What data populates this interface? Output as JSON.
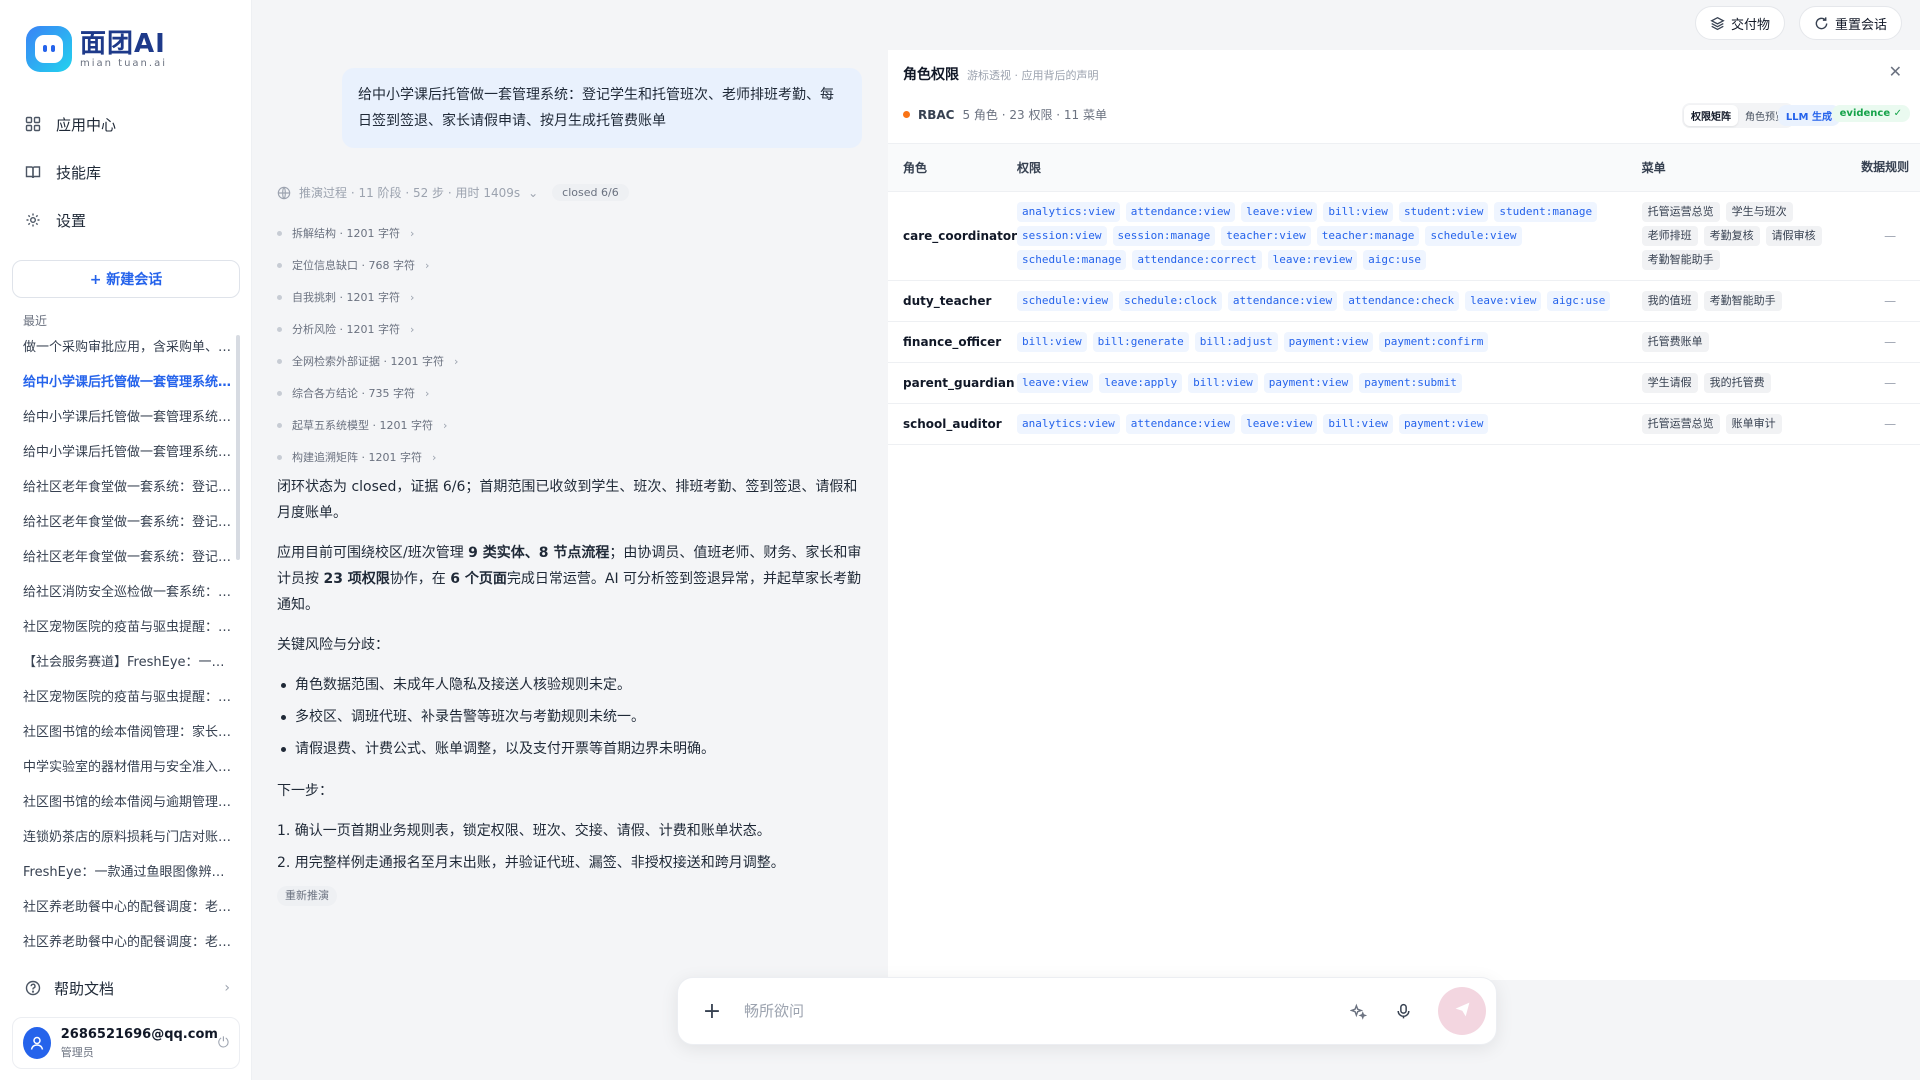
{
  "app": {
    "logo_title": "面团AI",
    "logo_sub": "mian tuan.ai"
  },
  "nav": [
    {
      "label": "应用中心",
      "icon": "grid-icon"
    },
    {
      "label": "技能库",
      "icon": "book-icon"
    },
    {
      "label": "设置",
      "icon": "gear-icon"
    }
  ],
  "new_chat_label": "+ 新建会话",
  "recent_label": "最近",
  "history": [
    "做一个采购审批应用，含采购单、经理审批和财务确认",
    "给中小学课后托管做一套管理系统：登记学生和托管班次",
    "给中小学课后托管做一套管理系统：登记学生和托管班次",
    "给中小学课后托管做一套管理系统：登记学生和托管班次",
    "给社区老年食堂做一套系统：登记就餐老人和餐次",
    "给社区老年食堂做一套系统：登记就餐老人和餐次",
    "给社区老年食堂做一套系统：登记就餐老人和餐次",
    "给社区消防安全巡检做一套系统：登记巡检点位",
    "社区宠物医院的疫苗与驱虫提醒：建立宠物档案",
    "【社会服务赛道】FreshEye：一款通过鱼眼图像辨别",
    "社区宠物医院的疫苗与驱虫提醒：建立宠物档案",
    "社区图书馆的绘本借阅管理：家长预约绘本",
    "中学实验室的器材借用与安全准入：登记器材",
    "社区图书馆的绘本借阅与逾期管理：登记读者",
    "连锁奶茶店的原料损耗与门店对账：登记原料",
    "FreshEye：一款通过鱼眼图像辨别水产新鲜度",
    "社区养老助餐中心的配餐调度：老人订餐",
    "社区养老助餐中心的配餐调度：老人订餐"
  ],
  "help_label": "帮助文档",
  "user": {
    "email": "2686521696@qq.com",
    "role": "管理员"
  },
  "top_buttons": {
    "deliverables": "交付物",
    "reset": "重置会话"
  },
  "chat": {
    "user_message": "给中小学课后托管做一套管理系统：登记学生和托管班次、老师排班考勤、每日签到签退、家长请假申请、按月生成托管费账单",
    "reasoning_summary": "推演过程 · 11 阶段 · 52 步 · 用时 1409s",
    "closed_tag": "closed 6/6",
    "steps": [
      "拆解结构 · 1201 字符",
      "定位信息缺口 · 768 字符",
      "自我挑刺 · 1201 字符",
      "分析风险 · 1201 字符",
      "全网检索外部证据 · 1201 字符",
      "综合各方结论 · 735 字符",
      "起草五系统模型 · 1201 字符",
      "构建追溯矩阵 · 1201 字符"
    ],
    "answer": {
      "p1": "闭环状态为 closed，证据 6/6；首期范围已收敛到学生、班次、排班考勤、签到签退、请假和月度账单。",
      "p2a": "应用目前可围绕校区/班次管理 ",
      "p2b": "9 类实体、8 节点流程",
      "p2c": "；由协调员、值班老师、财务、家长和审计员按 ",
      "p2d": "23 项权限",
      "p2e": "协作，在 ",
      "p2f": "6 个页面",
      "p2g": "完成日常运营。AI 可分析签到签退异常，并起草家长考勤通知。",
      "risk_title": "关键风险与分歧：",
      "risks": [
        "角色数据范围、未成年人隐私及接送人核验规则未定。",
        "多校区、调班代班、补录告警等班次与考勤规则未统一。",
        "请假退费、计费公式、账单调整，以及支付开票等首期边界未明确。"
      ],
      "next_title": "下一步：",
      "next_steps": [
        "1. 确认一页首期业务规则表，锁定权限、班次、交接、请假、计费和账单状态。",
        "2. 用完整样例走通报名至月末出账，并验证代班、漏签、非授权接送和跨月调整。"
      ],
      "rerun": "重新推演"
    }
  },
  "panel": {
    "title": "角色权限",
    "subtitle": "游标透视 · 应用背后的声明",
    "rbac_label": "RBAC",
    "rbac_meta": "5 角色 · 23 权限 · 11 菜单",
    "tabs": [
      "权限矩阵",
      "角色预览"
    ],
    "llm_badge": "LLM 生成",
    "evidence_badge": "evidence ✓",
    "columns": {
      "role": "角色",
      "perm": "权限",
      "menu": "菜单",
      "rule": "数据规则"
    },
    "rows": [
      {
        "role": "care_coordinator",
        "perms": [
          "analytics:view",
          "attendance:view",
          "leave:view",
          "bill:view",
          "student:view",
          "student:manage",
          "session:view",
          "session:manage",
          "teacher:view",
          "teacher:manage",
          "schedule:view",
          "schedule:manage",
          "attendance:correct",
          "leave:review",
          "aigc:use"
        ],
        "menus": [
          "托管运营总览",
          "学生与班次",
          "老师排班",
          "考勤复核",
          "请假审核",
          "考勤智能助手"
        ],
        "rule": "—"
      },
      {
        "role": "duty_teacher",
        "perms": [
          "schedule:view",
          "schedule:clock",
          "attendance:view",
          "attendance:check",
          "leave:view",
          "aigc:use"
        ],
        "menus": [
          "我的值班",
          "考勤智能助手"
        ],
        "rule": "—"
      },
      {
        "role": "finance_officer",
        "perms": [
          "bill:view",
          "bill:generate",
          "bill:adjust",
          "payment:view",
          "payment:confirm"
        ],
        "menus": [
          "托管费账单"
        ],
        "rule": "—"
      },
      {
        "role": "parent_guardian",
        "perms": [
          "leave:view",
          "leave:apply",
          "bill:view",
          "payment:view",
          "payment:submit"
        ],
        "menus": [
          "学生请假",
          "我的托管费"
        ],
        "rule": "—"
      },
      {
        "role": "school_auditor",
        "perms": [
          "analytics:view",
          "attendance:view",
          "leave:view",
          "bill:view",
          "payment:view"
        ],
        "menus": [
          "托管运营总览",
          "账单审计"
        ],
        "rule": "—"
      }
    ]
  },
  "composer": {
    "placeholder": "畅所欲问"
  },
  "colors": {
    "accent": "#2563eb",
    "bubble": "#e9f1fd",
    "rbac_dot": "#f97316",
    "send": "#f3d6e0"
  }
}
